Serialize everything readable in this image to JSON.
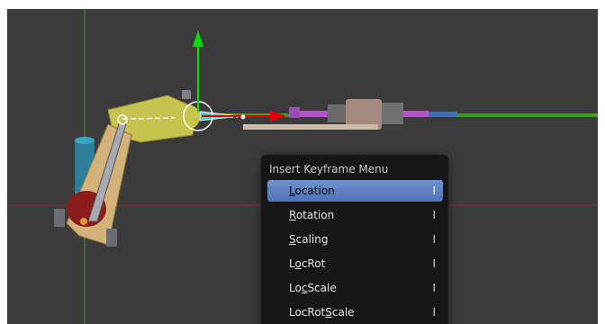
{
  "viewport": {
    "background": "#3b3b3b",
    "axis_x_color": "#8a2d2d",
    "axis_y_color": "#3f8f2f",
    "gizmo": {
      "z_arrow_color": "#00e000",
      "x_arrow_color": "#e00000"
    }
  },
  "menu": {
    "title": "Insert Keyframe Menu",
    "highlight_color": "#5b7fc0",
    "items": [
      {
        "pre": "",
        "mn": "L",
        "post": "ocation",
        "shortcut": "I",
        "active": true
      },
      {
        "pre": "",
        "mn": "R",
        "post": "otation",
        "shortcut": "I",
        "active": false
      },
      {
        "pre": "",
        "mn": "S",
        "post": "caling",
        "shortcut": "I",
        "active": false
      },
      {
        "pre": "L",
        "mn": "o",
        "post": "cRot",
        "shortcut": "I",
        "active": false
      },
      {
        "pre": "Lo",
        "mn": "c",
        "post": "Scale",
        "shortcut": "I",
        "active": false
      },
      {
        "pre": "LocRot",
        "mn": "S",
        "post": "cale",
        "shortcut": "I",
        "active": false
      }
    ]
  }
}
